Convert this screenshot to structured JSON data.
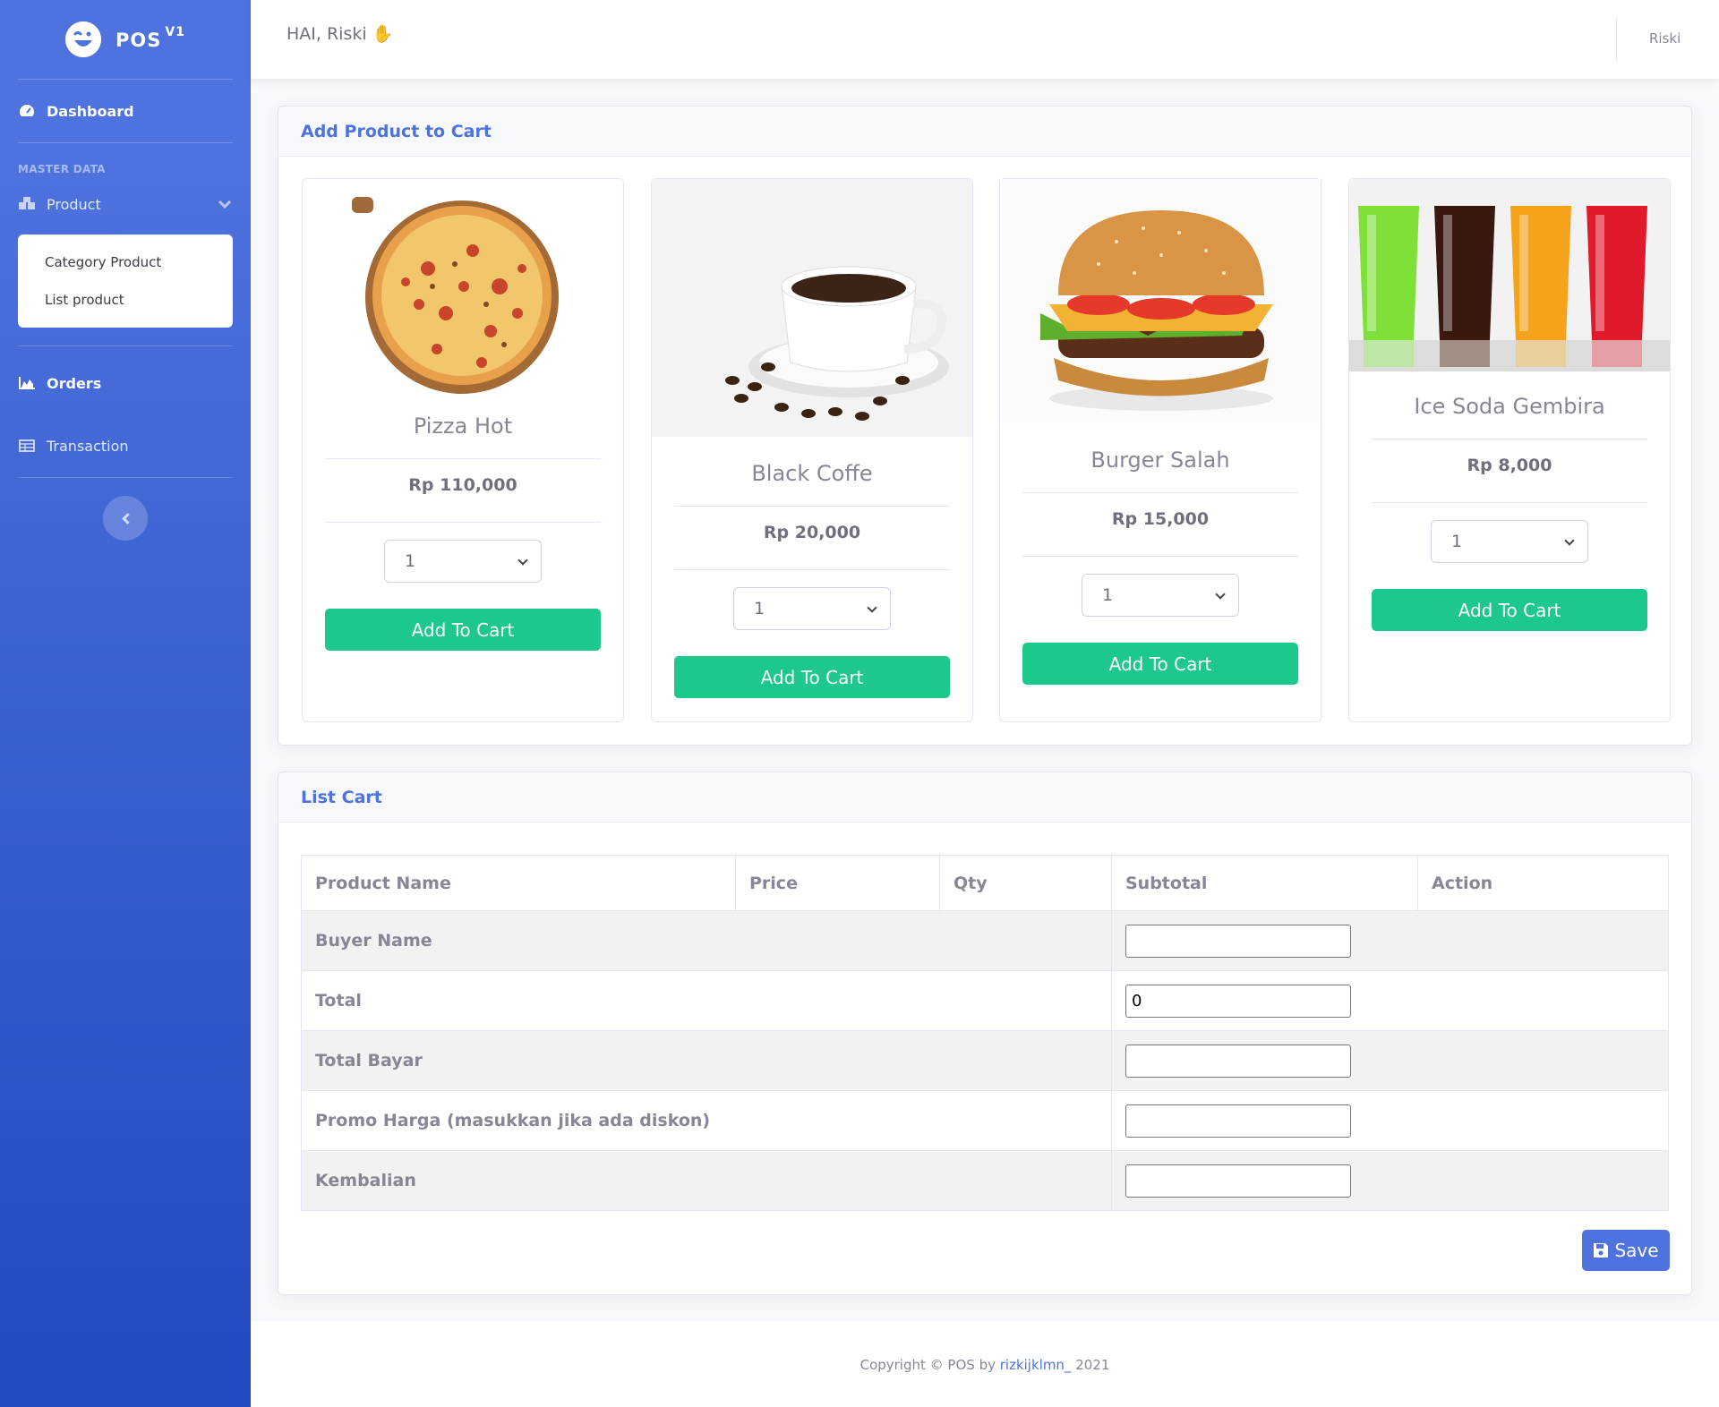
{
  "brand": {
    "name": "POS",
    "version": "V1"
  },
  "sidebar": {
    "dashboard": "Dashboard",
    "heading": "MASTER DATA",
    "product": "Product",
    "submenu": [
      "Category Product",
      "List product"
    ],
    "orders": "Orders",
    "transaction": "Transaction"
  },
  "topbar": {
    "greeting": "HAI, Riski",
    "greeting_emoji": "✋",
    "user": "Riski"
  },
  "add_card": {
    "title": "Add Product to Cart"
  },
  "products": [
    {
      "name": "Pizza Hot",
      "price": "Rp 110,000",
      "qty": "1",
      "button": "Add To Cart"
    },
    {
      "name": "Black Coffe",
      "price": "Rp 20,000",
      "qty": "1",
      "button": "Add To Cart"
    },
    {
      "name": "Burger Salah",
      "price": "Rp 15,000",
      "qty": "1",
      "button": "Add To Cart"
    },
    {
      "name": "Ice Soda Gembira",
      "price": "Rp 8,000",
      "qty": "1",
      "button": "Add To Cart"
    }
  ],
  "cart": {
    "title": "List Cart",
    "columns": [
      "Product Name",
      "Price",
      "Qty",
      "Subtotal",
      "Action"
    ],
    "rows": [
      {
        "label": "Buyer Name",
        "value": ""
      },
      {
        "label": "Total",
        "value": "0"
      },
      {
        "label": "Total Bayar",
        "value": ""
      },
      {
        "label": "Promo Harga (masukkan jika ada diskon)",
        "value": ""
      },
      {
        "label": "Kembalian",
        "value": ""
      }
    ],
    "save": "Save"
  },
  "footer": {
    "prefix": "Copyright © POS by ",
    "author": "rizkijklmn_",
    "year": " 2021"
  },
  "colors": {
    "primary": "#4e73df",
    "success": "#1cc88a"
  }
}
